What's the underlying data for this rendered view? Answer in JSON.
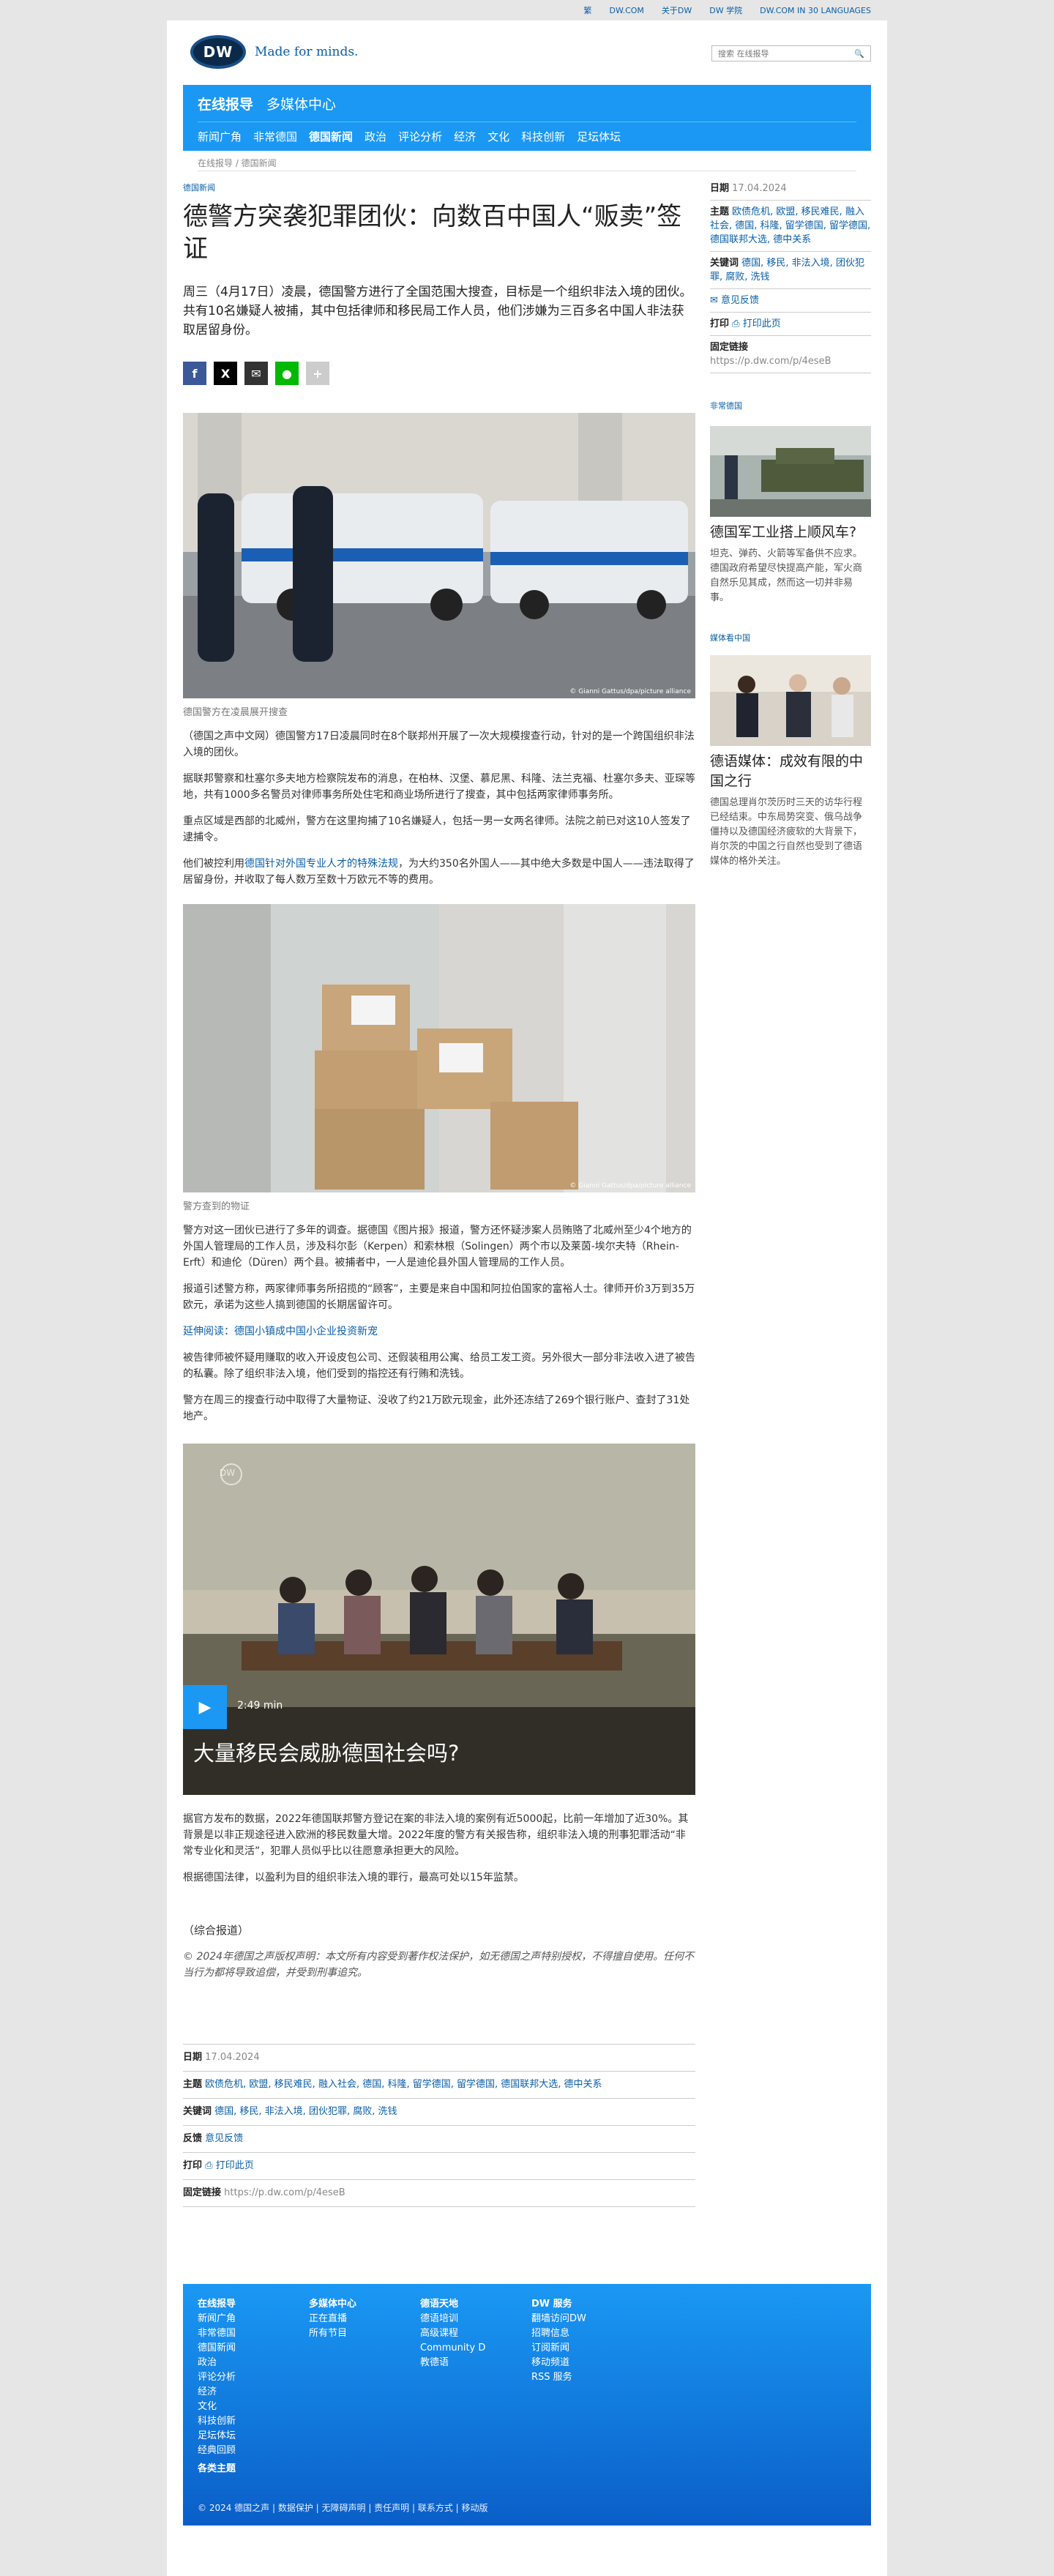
{
  "topbar": [
    "繁",
    "DW.COM",
    "关于DW",
    "DW 学院",
    "DW.COM IN 30 LANGUAGES"
  ],
  "brand": {
    "logo": "DW",
    "tagline": "Made for minds."
  },
  "search": {
    "placeholder": "搜索 在线报导"
  },
  "nav": {
    "primary": [
      "在线报导",
      "多媒体中心"
    ],
    "secondary": [
      "新闻广角",
      "非常德国",
      "德国新闻",
      "政治",
      "评论分析",
      "经济",
      "文化",
      "科技创新",
      "足坛体坛"
    ]
  },
  "breadcrumb": "在线报导 / 德国新闻",
  "article": {
    "kicker": "德国新闻",
    "title": "德警方突袭犯罪团伙：向数百中国人“贩卖”签证",
    "lead": "周三（4月17日）凌晨，德国警方进行了全国范围大搜查，目标是一个组织非法入境的团伙。共有10名嫌疑人被捕，其中包括律师和移民局工作人员，他们涉嫌为三百多名中国人非法获取居留身份。",
    "photo1_credit": "© Gianni Gattus/dpa/picture alliance",
    "photo1_caption": "德国警方在凌晨展开搜查",
    "p1": "（德国之声中文网）德国警方17日凌晨同时在8个联邦州开展了一次大规模搜查行动，针对的是一个跨国组织非法入境的团伙。",
    "p2": "据联邦警察和杜塞尔多夫地方检察院发布的消息，在柏林、汉堡、慕尼黑、科隆、法兰克福、杜塞尔多夫、亚琛等地，共有1000多名警员对律师事务所处住宅和商业场所进行了搜查，其中包括两家律师事务所。",
    "p3": "重点区域是西部的北威州，警方在这里拘捕了10名嫌疑人，包括一男一女两名律师。法院之前已对这10人签发了逮捕令。",
    "p4_pre": "他们被控利用",
    "p4_link": "德国针对外国专业人才的特殊法规",
    "p4_post": "，为大约350名外国人——其中绝大多数是中国人——违法取得了居留身份，并收取了每人数万至数十万欧元不等的费用。",
    "photo2_credit": "© Gianni Gattus/dpa/picture alliance",
    "photo2_caption": "警方查到的物证",
    "p5": "警方对这一团伙已进行了多年的调查。据德国《图片报》报道，警方还怀疑涉案人员贿赂了北威州至少4个地方的外国人管理局的工作人员，涉及科尔彭（Kerpen）和索林根（Solingen）两个市以及莱茵-埃尔夫特（Rhein-Erft）和迪伦（Düren）两个县。被捕者中，一人是迪伦县外国人管理局的工作人员。",
    "p6": "报道引述警方称，两家律师事务所招揽的“顾客”，主要是来自中国和阿拉伯国家的富裕人士。律师开价3万到35万欧元，承诺为这些人搞到德国的长期居留许可。",
    "further": "延伸阅读：德国小镇成中国小企业投资新宠",
    "p7": "被告律师被怀疑用赚取的收入开设皮包公司、还假装租用公寓、给员工发工资。另外很大一部分非法收入进了被告的私囊。除了组织非法入境，他们受到的指控还有行贿和洗钱。",
    "p8": "警方在周三的搜查行动中取得了大量物证、没收了约21万欧元现金，此外还冻结了269个银行账户、查封了31处地产。",
    "video": {
      "duration": "2:49 min",
      "title": "大量移民会威胁德国社会吗?",
      "watermark": "DW"
    },
    "p9": "据官方发布的数据，2022年德国联邦警方登记在案的非法入境的案例有近5000起，比前一年增加了近30%。其背景是以非正规途径进入欧洲的移民数量大增。2022年度的警方有关报告称，组织非法入境的刑事犯罪活动“非常专业化和灵活”，犯罪人员似乎比以往愿意承担更大的风险。",
    "p10": "根据德国法律，以盈利为目的组织非法入境的罪行，最高可处以15年监禁。",
    "source": "（综合报道）",
    "copyright": "© 2024年德国之声版权声明：本文所有内容受到著作权法保护，如无德国之声特别授权，不得擅自使用。任何不当行为都将导致追偿，并受到刑事追究。"
  },
  "meta": {
    "date_label": "日期",
    "date": "17.04.2024",
    "topics_label": "主题",
    "topics": "欧债危机, 欧盟, 移民难民, 融入社会, 德国, 科隆, 留学德国, 留学德国, 德国联邦大选, 德中关系",
    "topics_side": "欧债危机, 欧盟, 移民难民, 融入社会, 德国, 科隆, 留学德国, 留学德国, 德国联邦大选, 德中关系",
    "keywords_label": "关键词",
    "keywords": "德国, 移民, 非法入境, 团伙犯罪, 腐败, 洗钱",
    "feedback_label": "反馈",
    "feedback": "意见反馈",
    "print_label": "打印",
    "print": "打印此页",
    "permalink_label": "固定链接",
    "permalink": "https://p.dw.com/p/4eseB"
  },
  "sidebar": {
    "card1": {
      "head": "非常德国",
      "title": "德国军工业搭上顺风车?",
      "body": "坦克、弹药、火箭等军备供不应求。德国政府希望尽快提高产能，军火商自然乐见其成，然而这一切并非易事。"
    },
    "card2": {
      "head": "媒体看中国",
      "title": "德语媒体：成效有限的中国之行",
      "body": "德国总理肖尔茨历时三天的访华行程已经结束。中东局势突变、俄乌战争僵持以及德国经济疲软的大背景下，肖尔茨的中国之行自然也受到了德语媒体的格外关注。"
    }
  },
  "footer": {
    "cols": [
      {
        "head": "在线报导",
        "items": [
          "新闻广角",
          "非常德国",
          "德国新闻",
          "政治",
          "评论分析",
          "经济",
          "文化",
          "科技创新",
          "足坛体坛",
          "经典回顾"
        ]
      },
      {
        "head": "多媒体中心",
        "items": [
          "正在直播",
          "所有节目"
        ]
      },
      {
        "head": "德语天地",
        "items": [
          "德语培训",
          "高级课程",
          "Community D",
          "教德语"
        ]
      },
      {
        "head": "DW 服务",
        "items": [
          "翻墙访问DW",
          "招聘信息",
          "订阅新闻",
          "移动频道",
          "RSS 服务"
        ]
      }
    ],
    "topics": "各类主题",
    "bottom": "© 2024 德国之声 | 数据保护 | 无障碍声明 | 责任声明 | 联系方式 | 移动版"
  },
  "colors": {
    "accent": "#1a98f4",
    "link": "#0a5ea8"
  }
}
